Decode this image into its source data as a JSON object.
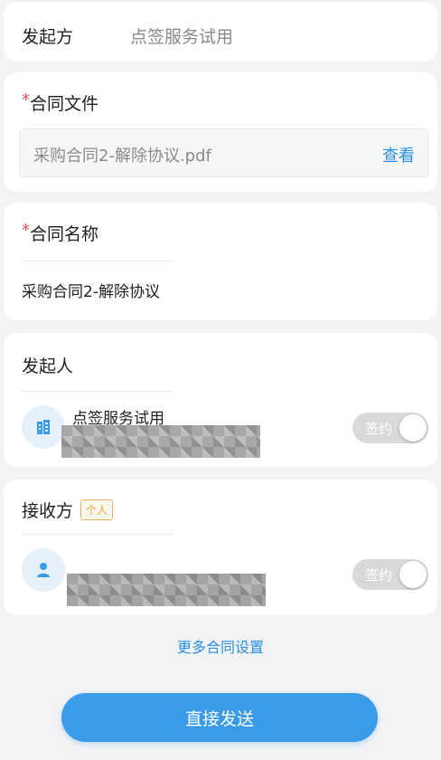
{
  "initiator": {
    "label": "发起方",
    "value": "点签服务试用"
  },
  "contract_file": {
    "required_mark": "*",
    "label": "合同文件",
    "file_name": "采购合同2-解除协议.pdf",
    "view_label": "查看"
  },
  "contract_name": {
    "required_mark": "*",
    "label": "合同名称",
    "value": "采购合同2-解除协议"
  },
  "sender": {
    "label": "发起人",
    "org_name": "点签服务试用",
    "avatar_icon": "building-icon",
    "sign_toggle_label": "签约"
  },
  "receiver": {
    "label": "接收方",
    "tag": "个人",
    "avatar_icon": "person-icon",
    "sign_toggle_label": "签约"
  },
  "more_settings_label": "更多合同设置",
  "send_button_label": "直接发送",
  "colors": {
    "accent": "#3a9be8",
    "link": "#2b8de0",
    "required": "#e9524a",
    "tag": "#f0a040"
  }
}
